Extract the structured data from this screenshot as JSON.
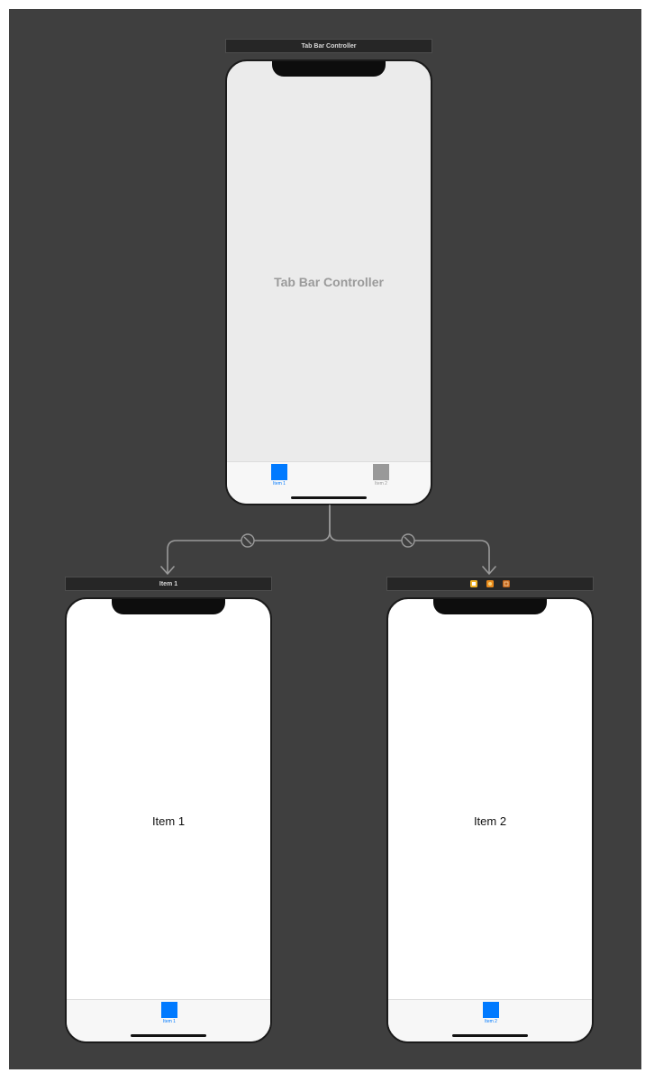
{
  "colors": {
    "canvas_bg": "#3f3f3f",
    "scene_bar_bg": "#262626",
    "accent": "#007aff",
    "inactive_tab": "#999999",
    "segue_line": "#9a9a9a"
  },
  "tab_bar_controller": {
    "scene_title": "Tab Bar Controller",
    "center_label": "Tab Bar Controller",
    "tabs": [
      {
        "label": "Item 1",
        "icon": "square-tab-icon",
        "selected": true
      },
      {
        "label": "Item 2",
        "icon": "square-tab-icon",
        "selected": false
      }
    ]
  },
  "segues": [
    {
      "from": "Tab Bar Controller",
      "to": "Item 1",
      "icon": "relationship-segue-icon"
    },
    {
      "from": "Tab Bar Controller",
      "to": "Item 2",
      "icon": "relationship-segue-icon"
    }
  ],
  "item1_scene": {
    "scene_title": "Item 1",
    "center_label": "Item 1",
    "tab_label": "Item 1"
  },
  "item2_scene": {
    "scene_icons": [
      "view-controller-icon",
      "first-responder-icon",
      "exit-icon"
    ],
    "center_label": "Item 2",
    "tab_label": "Item 2"
  }
}
